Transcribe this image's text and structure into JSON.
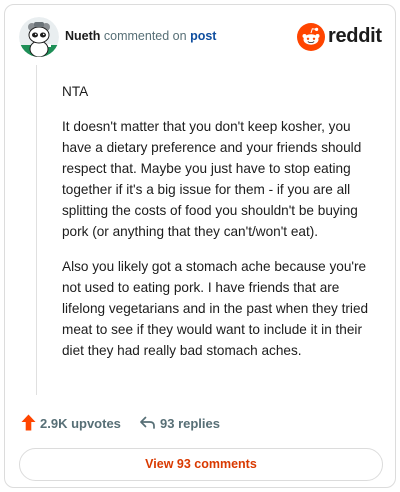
{
  "header": {
    "username": "Nueth",
    "commented_text": "commented on",
    "post_link": "post",
    "brand": "reddit"
  },
  "comment": {
    "paragraphs": [
      "NTA",
      "It doesn't matter that you don't keep kosher, you have a dietary preference and your friends should respect that. Maybe you just have to stop eating together if it's a big issue for them - if you are all splitting the costs of food you shouldn't be buying pork (or anything that they can't/won't eat).",
      "Also you likely got a stomach ache because you're not used to eating pork. I have friends that are lifelong vegetarians and in the past when they tried meat to see if they would want to include it in their diet they had really bad stomach aches."
    ]
  },
  "actions": {
    "upvotes": "2.9K upvotes",
    "replies": "93 replies"
  },
  "footer": {
    "view_comments_label": "View 93 comments"
  },
  "colors": {
    "brand_orange": "#ff4500",
    "link_blue": "#0f4e9f",
    "view_button_text": "#d93900"
  },
  "icons": {
    "avatar": "snoo-avatar",
    "logo": "reddit-logo-icon",
    "upvote": "upvote-arrow-icon",
    "reply": "reply-arrow-icon"
  }
}
